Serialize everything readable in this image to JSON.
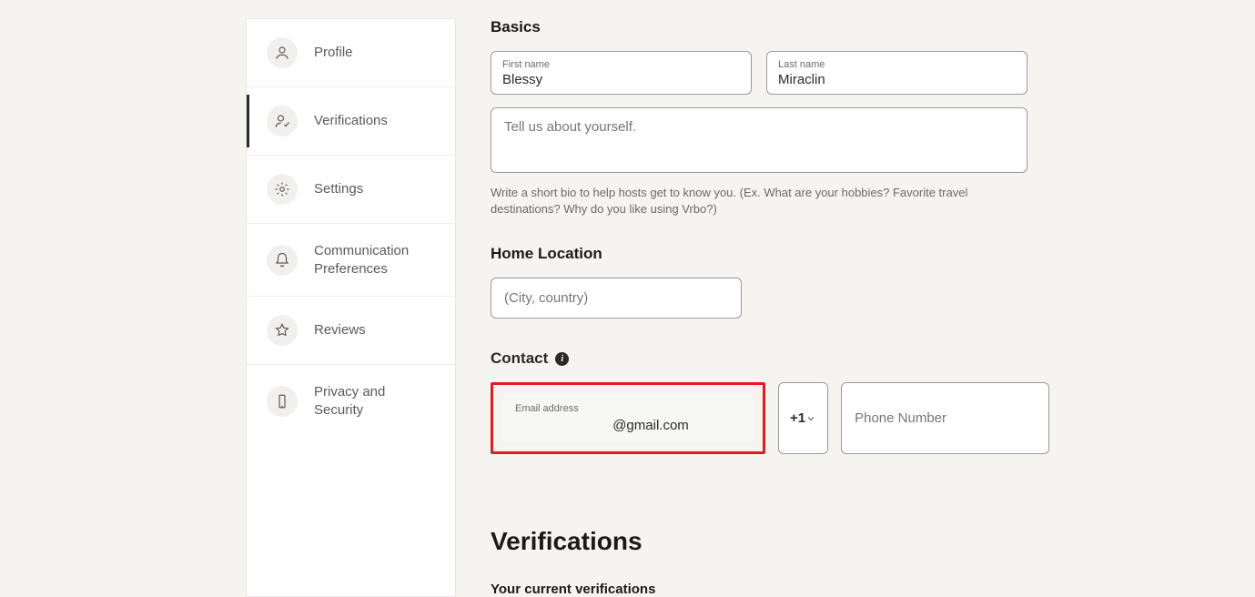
{
  "sidebar": {
    "items": [
      {
        "label": "Profile"
      },
      {
        "label": "Verifications"
      },
      {
        "label": "Settings"
      },
      {
        "label": "Communication Preferences"
      },
      {
        "label": "Reviews"
      },
      {
        "label": "Privacy and Security"
      }
    ]
  },
  "basics": {
    "heading": "Basics",
    "first_name_label": "First name",
    "first_name_value": "Blessy",
    "last_name_label": "Last name",
    "last_name_value": "Miraclin",
    "bio_placeholder": "Tell us about yourself.",
    "bio_help": "Write a short bio to help hosts get to know you. (Ex. What are your hobbies? Favorite travel destinations? Why do you like using Vrbo?)"
  },
  "home_location": {
    "heading": "Home Location",
    "placeholder": "(City, country)"
  },
  "contact": {
    "heading": "Contact",
    "email_label": "Email address",
    "email_value": "@gmail.com",
    "country_code": "+1",
    "phone_placeholder": "Phone Number"
  },
  "verifications": {
    "heading": "Verifications",
    "sub_heading": "Your current verifications"
  }
}
